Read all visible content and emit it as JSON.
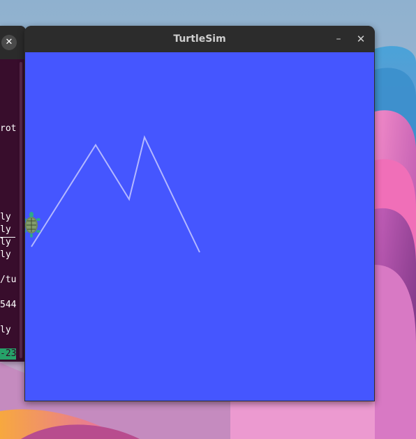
{
  "desktop": {
    "wallpaper_colors": [
      "#8fb1cf",
      "#e86bb5",
      "#f7a03b",
      "#b64fa8",
      "#7d3a84"
    ]
  },
  "terminal": {
    "close_icon": "close-icon",
    "close_glyph": "✕",
    "lines": [
      {
        "text": "rot"
      },
      {
        "text": "ly"
      },
      {
        "text": "ly"
      },
      {
        "text": "ly"
      },
      {
        "text": "ly"
      },
      {
        "text": "/tu"
      },
      {
        "text": "544"
      },
      {
        "text": "ly"
      }
    ],
    "highlight_text": "-23",
    "colors": {
      "background": "#300a24",
      "highlight": "#26a269"
    }
  },
  "turtlesim": {
    "title": "TurtleSim",
    "minimize_glyph": "–",
    "close_glyph": "✕",
    "canvas_color": "#4556ff",
    "pen_color": "#b3b8ff",
    "turtle_icon": "turtle-icon"
  }
}
